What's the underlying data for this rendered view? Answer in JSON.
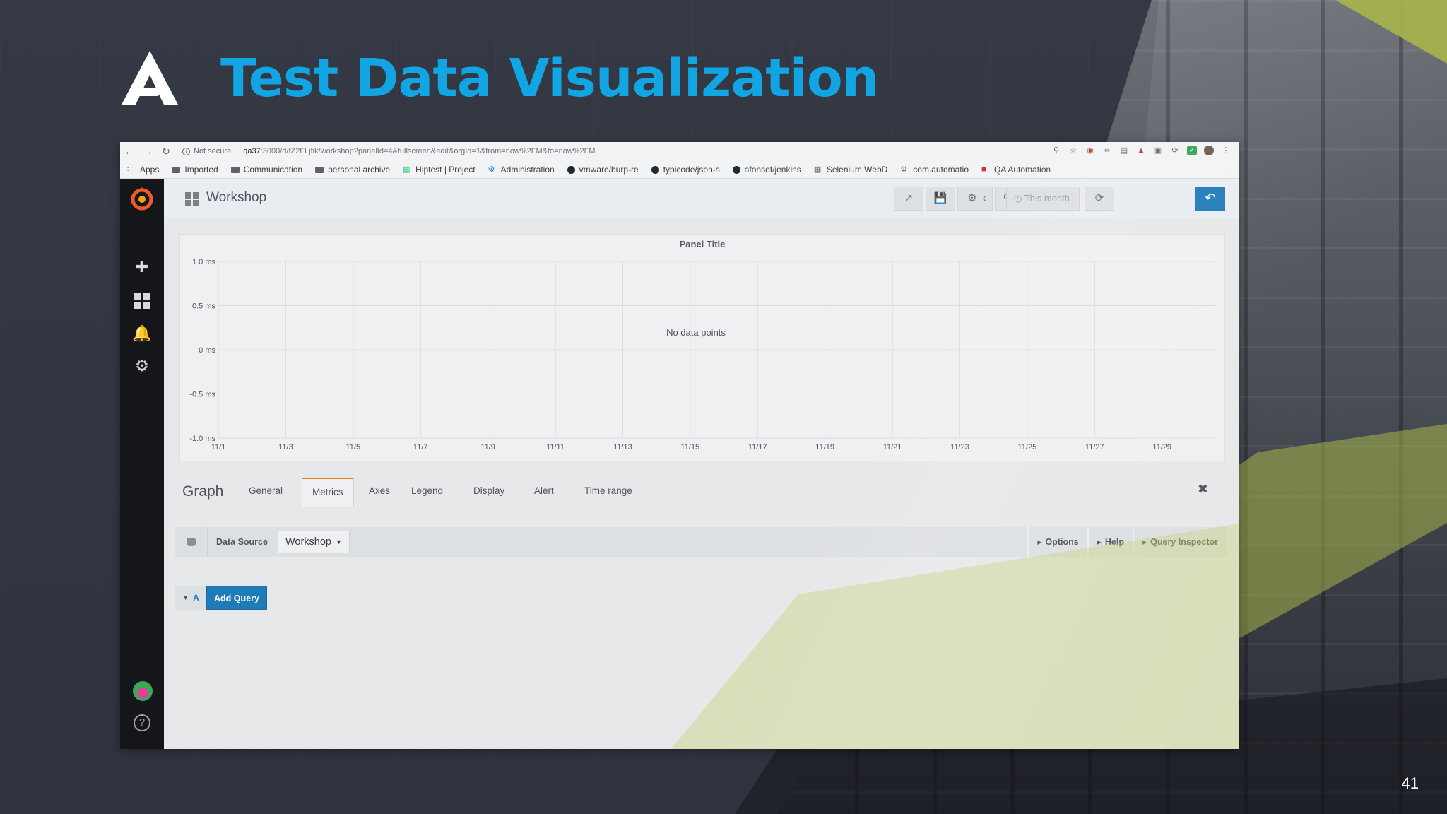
{
  "slide": {
    "title": "Test Data Visualization",
    "page_number": "41",
    "title_color": "#12a5e3"
  },
  "browser": {
    "security": "Not secure",
    "url_host": "qa37",
    "url_path": ":3000/d/fZ2FLjfik/workshop?panelId=4&fullscreen&edit&orgId=1&from=now%2FM&to=now%2FM",
    "bookmarks": [
      {
        "icon": "apps-icon",
        "label": "Apps"
      },
      {
        "icon": "folder-icon",
        "label": "Imported"
      },
      {
        "icon": "folder-icon",
        "label": "Communication"
      },
      {
        "icon": "folder-icon",
        "label": "personal archive"
      },
      {
        "icon": "hiptest-icon",
        "label": "Hiptest | Project"
      },
      {
        "icon": "admin-icon",
        "label": "Administration"
      },
      {
        "icon": "github-icon",
        "label": "vmware/burp-re"
      },
      {
        "icon": "github-icon",
        "label": "typicode/json-s"
      },
      {
        "icon": "github-icon",
        "label": "afonsof/jenkins"
      },
      {
        "icon": "selenium-icon",
        "label": "Selenium WebD"
      },
      {
        "icon": "gear-icon",
        "label": "com.automatio"
      },
      {
        "icon": "qa-icon",
        "label": "QA Automation"
      }
    ]
  },
  "grafana": {
    "dashboard_title": "Workshop",
    "time_range": "This month",
    "panel": {
      "title": "Panel Title",
      "empty_message": "No data points"
    },
    "editor": {
      "title": "Graph",
      "tabs": [
        "General",
        "Metrics",
        "Axes",
        "Legend",
        "Display",
        "Alert",
        "Time range"
      ],
      "active_tab": "Metrics"
    },
    "data_source": {
      "label": "Data Source",
      "selected": "Workshop",
      "options": [
        "Options",
        "Help",
        "Query Inspector"
      ]
    },
    "query": {
      "ref_id": "A",
      "add_label": "Add Query"
    },
    "accent_color": "#1f7ab8",
    "active_tab_color": "#eb7b18"
  },
  "chart_data": {
    "type": "line",
    "title": "Panel Title",
    "x": [
      "11/1",
      "11/3",
      "11/5",
      "11/7",
      "11/9",
      "11/11",
      "11/13",
      "11/15",
      "11/17",
      "11/19",
      "11/21",
      "11/23",
      "11/25",
      "11/27",
      "11/29"
    ],
    "y_ticks": [
      "1.0 ms",
      "0.5 ms",
      "0 ms",
      "-0.5 ms",
      "-1.0 ms"
    ],
    "ylim": [
      -1.0,
      1.0
    ],
    "series": [],
    "grid": true,
    "annotation": "No data points"
  }
}
